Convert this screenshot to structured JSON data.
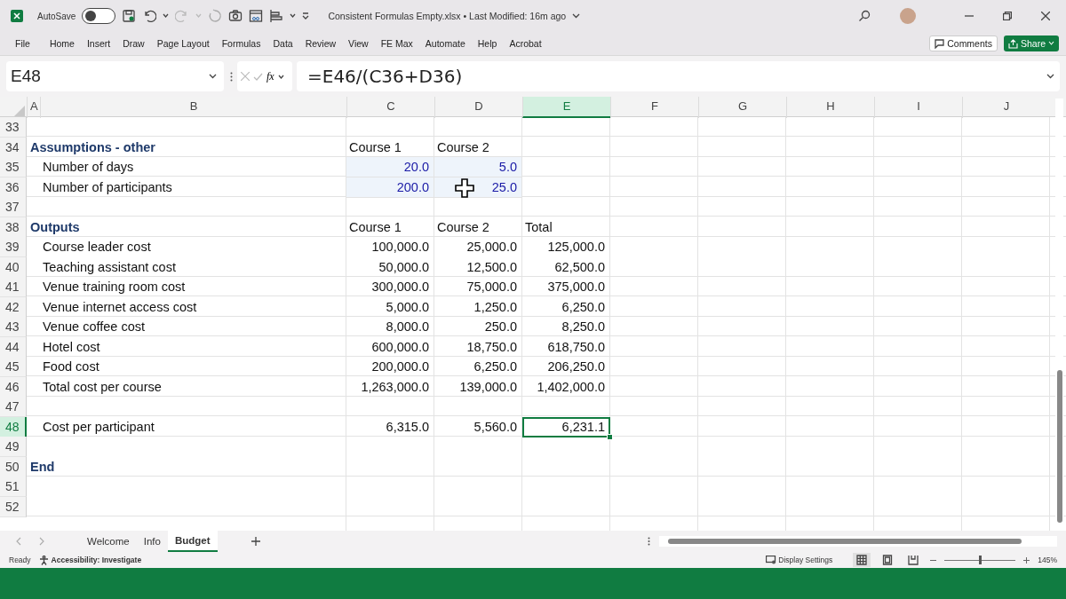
{
  "title_bar": {
    "autosave_label": "AutoSave",
    "autosave_on": false,
    "document_title": "Consistent Formulas Empty.xlsx • Last Modified: 16m ago"
  },
  "menu": [
    {
      "label": "File"
    },
    {
      "label": "Home"
    },
    {
      "label": "Insert"
    },
    {
      "label": "Draw"
    },
    {
      "label": "Page Layout"
    },
    {
      "label": "Formulas"
    },
    {
      "label": "Data"
    },
    {
      "label": "Review"
    },
    {
      "label": "View"
    },
    {
      "label": "FE Max"
    },
    {
      "label": "Automate"
    },
    {
      "label": "Help"
    },
    {
      "label": "Acrobat"
    }
  ],
  "ribbon_buttons": {
    "comments": "Comments",
    "share": "Share"
  },
  "formula_bar": {
    "name_box": "E48",
    "fx": "fx",
    "formula": "=E46/(C36+D36)"
  },
  "columns": [
    {
      "label": "A",
      "selected": false
    },
    {
      "label": "B",
      "selected": false
    },
    {
      "label": "C",
      "selected": false
    },
    {
      "label": "D",
      "selected": false
    },
    {
      "label": "E",
      "selected": true
    },
    {
      "label": "F",
      "selected": false
    },
    {
      "label": "G",
      "selected": false
    },
    {
      "label": "H",
      "selected": false
    },
    {
      "label": "I",
      "selected": false
    },
    {
      "label": "J",
      "selected": false
    }
  ],
  "rows": [
    {
      "number": "33",
      "selected": false
    },
    {
      "number": "34",
      "selected": false,
      "label": "Assumptions - other",
      "kind": "heading",
      "c": {
        "text": "Course 1",
        "kind": "text",
        "input": false,
        "selected": false
      },
      "d": {
        "text": "Course 2",
        "kind": "text",
        "input": false,
        "selected": false
      }
    },
    {
      "number": "35",
      "selected": false,
      "label": "Number of days",
      "kind": "item",
      "c": {
        "text": "20.0",
        "kind": "number",
        "input": true,
        "selected": false
      },
      "d": {
        "text": "5.0",
        "kind": "number",
        "input": true,
        "selected": false
      }
    },
    {
      "number": "36",
      "selected": false,
      "label": "Number of participants",
      "kind": "item",
      "c": {
        "text": "200.0",
        "kind": "number",
        "input": true,
        "selected": false
      },
      "d": {
        "text": "25.0",
        "kind": "number",
        "input": true,
        "selected": false
      }
    },
    {
      "number": "37",
      "selected": false
    },
    {
      "number": "38",
      "selected": false,
      "label": "Outputs",
      "kind": "heading",
      "c": {
        "text": "Course 1",
        "kind": "text",
        "input": false,
        "selected": false
      },
      "d": {
        "text": "Course 2",
        "kind": "text",
        "input": false,
        "selected": false
      },
      "e": {
        "text": "Total",
        "kind": "text",
        "input": false,
        "selected": false
      }
    },
    {
      "number": "39",
      "selected": false,
      "label": "Course leader cost",
      "kind": "item",
      "c": {
        "text": "100,000.0",
        "kind": "number",
        "input": false,
        "selected": false
      },
      "d": {
        "text": "25,000.0",
        "kind": "number",
        "input": false,
        "selected": false
      },
      "e": {
        "text": "125,000.0",
        "kind": "number",
        "input": false,
        "selected": false
      }
    },
    {
      "number": "40",
      "selected": false,
      "label": "Teaching assistant cost",
      "kind": "item",
      "c": {
        "text": "50,000.0",
        "kind": "number",
        "input": false,
        "selected": false
      },
      "d": {
        "text": "12,500.0",
        "kind": "number",
        "input": false,
        "selected": false
      },
      "e": {
        "text": "62,500.0",
        "kind": "number",
        "input": false,
        "selected": false
      }
    },
    {
      "number": "41",
      "selected": false,
      "label": "Venue training room cost",
      "kind": "item",
      "c": {
        "text": "300,000.0",
        "kind": "number",
        "input": false,
        "selected": false
      },
      "d": {
        "text": "75,000.0",
        "kind": "number",
        "input": false,
        "selected": false
      },
      "e": {
        "text": "375,000.0",
        "kind": "number",
        "input": false,
        "selected": false
      }
    },
    {
      "number": "42",
      "selected": false,
      "label": "Venue internet access cost",
      "kind": "item",
      "c": {
        "text": "5,000.0",
        "kind": "number",
        "input": false,
        "selected": false
      },
      "d": {
        "text": "1,250.0",
        "kind": "number",
        "input": false,
        "selected": false
      },
      "e": {
        "text": "6,250.0",
        "kind": "number",
        "input": false,
        "selected": false
      }
    },
    {
      "number": "43",
      "selected": false,
      "label": "Venue coffee cost",
      "kind": "item",
      "c": {
        "text": "8,000.0",
        "kind": "number",
        "input": false,
        "selected": false
      },
      "d": {
        "text": "250.0",
        "kind": "number",
        "input": false,
        "selected": false
      },
      "e": {
        "text": "8,250.0",
        "kind": "number",
        "input": false,
        "selected": false
      }
    },
    {
      "number": "44",
      "selected": false,
      "label": "Hotel cost",
      "kind": "item",
      "c": {
        "text": "600,000.0",
        "kind": "number",
        "input": false,
        "selected": false
      },
      "d": {
        "text": "18,750.0",
        "kind": "number",
        "input": false,
        "selected": false
      },
      "e": {
        "text": "618,750.0",
        "kind": "number",
        "input": false,
        "selected": false
      }
    },
    {
      "number": "45",
      "selected": false,
      "label": "Food cost",
      "kind": "item",
      "c": {
        "text": "200,000.0",
        "kind": "number",
        "input": false,
        "selected": false
      },
      "d": {
        "text": "6,250.0",
        "kind": "number",
        "input": false,
        "selected": false
      },
      "e": {
        "text": "206,250.0",
        "kind": "number",
        "input": false,
        "selected": false
      }
    },
    {
      "number": "46",
      "selected": false,
      "label": "Total cost per course",
      "kind": "item",
      "c": {
        "text": "1,263,000.0",
        "kind": "number",
        "input": false,
        "selected": false
      },
      "d": {
        "text": "139,000.0",
        "kind": "number",
        "input": false,
        "selected": false
      },
      "e": {
        "text": "1,402,000.0",
        "kind": "number",
        "input": false,
        "selected": false
      }
    },
    {
      "number": "47",
      "selected": false
    },
    {
      "number": "48",
      "selected": true,
      "label": "Cost per participant",
      "kind": "item",
      "c": {
        "text": "6,315.0",
        "kind": "number",
        "input": false,
        "selected": false
      },
      "d": {
        "text": "5,560.0",
        "kind": "number",
        "input": false,
        "selected": false
      },
      "e": {
        "text": "6,231.1",
        "kind": "number",
        "input": false,
        "selected": true
      }
    },
    {
      "number": "49",
      "selected": false
    },
    {
      "number": "50",
      "selected": false,
      "label": "End",
      "kind": "heading"
    },
    {
      "number": "51",
      "selected": false
    },
    {
      "number": "52",
      "selected": false
    }
  ],
  "sheet_tabs": [
    {
      "label": "Welcome",
      "selected": false
    },
    {
      "label": "Info",
      "selected": false
    },
    {
      "label": "Budget",
      "selected": true
    }
  ],
  "status_bar": {
    "ready": "Ready",
    "accessibility": "Accessibility: Investigate",
    "display_settings": "Display Settings",
    "views": [
      {
        "kind": "normal",
        "selected": true
      },
      {
        "kind": "page-layout",
        "selected": false
      },
      {
        "kind": "page-break",
        "selected": false
      }
    ],
    "level": 0.5,
    "zoom": "145%"
  }
}
